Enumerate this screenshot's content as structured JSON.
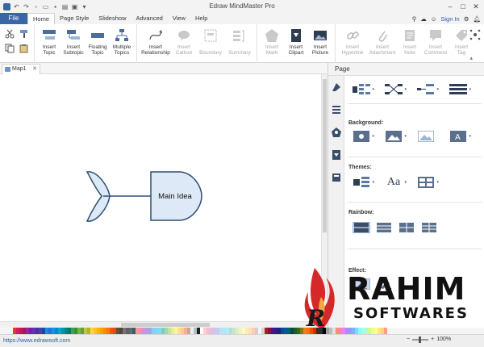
{
  "window": {
    "title": "Edraw MindMaster Pro",
    "controls": [
      "minimize-icon",
      "maximize-icon",
      "close-icon"
    ]
  },
  "menu": {
    "file": "File",
    "tabs": [
      "Home",
      "Page Style",
      "Slideshow",
      "Advanced",
      "View",
      "Help"
    ],
    "active_tab": "Home",
    "sign_in": "Sign In"
  },
  "ribbon": {
    "groups": [
      {
        "buttons": [
          {
            "line1": "Insert",
            "line2": "Topic",
            "enabled": true
          },
          {
            "line1": "Insert",
            "line2": "Subtopic",
            "enabled": true
          },
          {
            "line1": "Floating",
            "line2": "Topic",
            "enabled": true
          },
          {
            "line1": "Multiple",
            "line2": "Topics",
            "enabled": true
          }
        ]
      },
      {
        "buttons": [
          {
            "line1": "Insert",
            "line2": "Relationship",
            "enabled": true
          },
          {
            "line1": "Insert",
            "line2": "Callout",
            "enabled": false
          },
          {
            "line1": "",
            "line2": "Boundary",
            "enabled": false
          },
          {
            "line1": "",
            "line2": "Summary",
            "enabled": false
          }
        ]
      },
      {
        "buttons": [
          {
            "line1": "Insert",
            "line2": "Mark",
            "enabled": false
          },
          {
            "line1": "Insert",
            "line2": "Clipart",
            "enabled": true
          },
          {
            "line1": "Insert",
            "line2": "Picture",
            "enabled": true
          }
        ]
      },
      {
        "buttons": [
          {
            "line1": "Insert",
            "line2": "Hyperlink",
            "enabled": false
          },
          {
            "line1": "Insert",
            "line2": "Attachment",
            "enabled": false
          },
          {
            "line1": "Insert",
            "line2": "Note",
            "enabled": false
          },
          {
            "line1": "Insert",
            "line2": "Comment",
            "enabled": false
          },
          {
            "line1": "Insert",
            "line2": "Tag",
            "enabled": false
          }
        ]
      }
    ]
  },
  "document": {
    "tab_label": "Map1"
  },
  "canvas": {
    "main_topic": "Main Idea"
  },
  "panel": {
    "title": "Page",
    "background_label": "Background:",
    "themes_label": "Themes:",
    "rainbow_label": "Rainbow:",
    "effect_label": "Effect:",
    "theme_font_glyph": "Aa"
  },
  "status": {
    "url": "https://www.edrawsoft.com",
    "zoom": "100%"
  },
  "watermark": {
    "line1": "RAHIM",
    "line2": "SOFTWARES"
  },
  "colors": {
    "accent": "#3a66a8",
    "topic_fill": "#dde9f7",
    "topic_stroke": "#2f4f72",
    "palette": [
      "#e53935",
      "#d81b60",
      "#c2185b",
      "#ad1457",
      "#8e24aa",
      "#7b1fa2",
      "#5e35b1",
      "#512da8",
      "#3949ab",
      "#303f9f",
      "#1e88e5",
      "#1976d2",
      "#039be5",
      "#0288d1",
      "#00acc1",
      "#0097a7",
      "#00897b",
      "#00796b",
      "#43a047",
      "#388e3c",
      "#7cb342",
      "#689f38",
      "#c0ca33",
      "#afb42b",
      "#fdd835",
      "#fbc02d",
      "#ffb300",
      "#ffa000",
      "#fb8c00",
      "#f57c00",
      "#f4511e",
      "#e64a19",
      "#6d4c41",
      "#5d4037",
      "#757575",
      "#616161",
      "#546e7a",
      "#455a64",
      "#ef9a9a",
      "#f48fb1",
      "#ce93d8",
      "#b39ddb",
      "#9fa8da",
      "#90caf9",
      "#81d4fa",
      "#80deea",
      "#80cbc4",
      "#a5d6a7",
      "#c5e1a5",
      "#e6ee9c",
      "#fff59d",
      "#ffe082",
      "#ffcc80",
      "#ffab91",
      "#bcaaa4",
      "#eeeeee",
      "#b0bec5",
      "#212121",
      "#ffffff",
      "#ffcdd2",
      "#f8bbd0",
      "#e1bee7",
      "#d1c4e9",
      "#c5cae9",
      "#bbdefb",
      "#b3e5fc",
      "#b2ebf2",
      "#b2dfdb",
      "#c8e6c9",
      "#dcedc8",
      "#f0f4c3",
      "#fff9c4",
      "#ffecb3",
      "#ffe0b2",
      "#ffccbc",
      "#d7ccc8",
      "#f5f5f5",
      "#cfd8dc",
      "#b71c1c",
      "#880e4f",
      "#4a148c",
      "#311b92",
      "#1a237e",
      "#0d47a1",
      "#01579b",
      "#006064",
      "#004d40",
      "#1b5e20",
      "#33691e",
      "#827717",
      "#f57f17",
      "#ff6f00",
      "#e65100",
      "#bf360c",
      "#3e2723",
      "#263238",
      "#000000",
      "#9e9e9e",
      "#bdbdbd",
      "#e0e0e0",
      "#ff8a80",
      "#ff80ab",
      "#ea80fc",
      "#b388ff",
      "#8c9eff",
      "#82b1ff",
      "#80d8ff",
      "#84ffff",
      "#a7ffeb",
      "#b9f6ca",
      "#ccff90",
      "#f4ff81",
      "#ffff8d",
      "#ffe57f",
      "#ffd180",
      "#ff9e80"
    ]
  }
}
